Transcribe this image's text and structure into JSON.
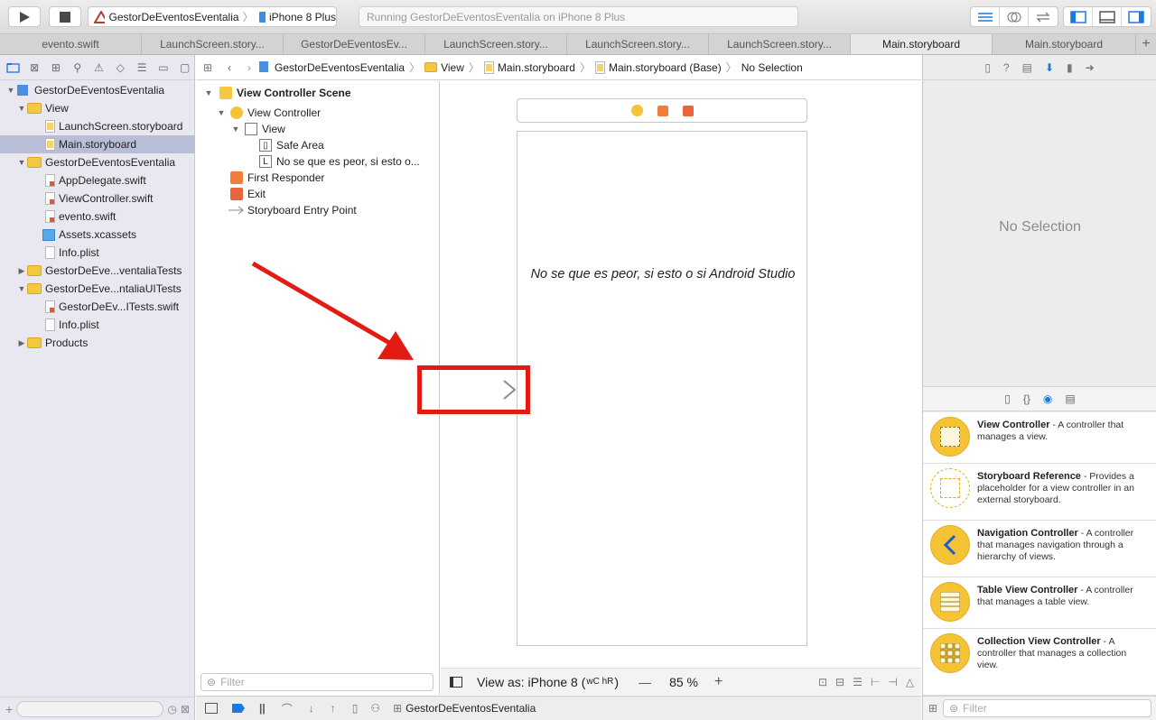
{
  "toolbar": {
    "scheme_name": "GestorDeEventosEventalia",
    "device": "iPhone 8 Plus",
    "status": "Running GestorDeEventosEventalia on iPhone 8 Plus"
  },
  "tabs": [
    {
      "label": "evento.swift"
    },
    {
      "label": "LaunchScreen.story..."
    },
    {
      "label": "GestorDeEventosEv..."
    },
    {
      "label": "LaunchScreen.story..."
    },
    {
      "label": "LaunchScreen.story..."
    },
    {
      "label": "LaunchScreen.story..."
    },
    {
      "label": "Main.storyboard"
    },
    {
      "label": "Main.storyboard"
    }
  ],
  "navigator": {
    "items": [
      {
        "label": "GestorDeEventosEventalia"
      },
      {
        "label": "View"
      },
      {
        "label": "LaunchScreen.storyboard"
      },
      {
        "label": "Main.storyboard"
      },
      {
        "label": "GestorDeEventosEventalia"
      },
      {
        "label": "AppDelegate.swift"
      },
      {
        "label": "ViewController.swift"
      },
      {
        "label": "evento.swift"
      },
      {
        "label": "Assets.xcassets"
      },
      {
        "label": "Info.plist"
      },
      {
        "label": "GestorDeEve...ventaliaTests"
      },
      {
        "label": "GestorDeEve...ntaliaUITests"
      },
      {
        "label": "GestorDeEv...ITests.swift"
      },
      {
        "label": "Info.plist"
      },
      {
        "label": "Products"
      }
    ]
  },
  "jumpbar": [
    "GestorDeEventosEventalia",
    "View",
    "Main.storyboard",
    "Main.storyboard (Base)",
    "No Selection"
  ],
  "outline": {
    "scene": "View Controller Scene",
    "view_controller": "View Controller",
    "view": "View",
    "safe_area": "Safe Area",
    "label": "No se que es peor, si esto o...",
    "first_responder": "First Responder",
    "exit": "Exit",
    "entry_point": "Storyboard Entry Point",
    "filter_placeholder": "Filter"
  },
  "canvas": {
    "label_text": "No se que es peor, si esto o si Android Studio",
    "view_as": "View as: iPhone 8 (",
    "size_classes": "wC hR",
    "view_as_close": ")",
    "zoom": "85 %",
    "zoom_out": "—",
    "zoom_in": "+"
  },
  "debugbar": {
    "target": "GestorDeEventosEventalia"
  },
  "inspector": {
    "no_selection": "No Selection",
    "filter_placeholder": "Filter",
    "library": [
      {
        "title": "View Controller",
        "desc": " - A controller that manages a view."
      },
      {
        "title": "Storyboard Reference",
        "desc": " - Provides a placeholder for a view controller in an external storyboard."
      },
      {
        "title": "Navigation Controller",
        "desc": " - A controller that manages navigation through a hierarchy of views."
      },
      {
        "title": "Table View Controller",
        "desc": " - A controller that manages a table view."
      },
      {
        "title": "Collection View Controller",
        "desc": " - A controller that manages a collection view."
      }
    ]
  },
  "colors": {
    "annotation_red": "#e31c13",
    "folder_yellow": "#f5c842",
    "selection": "#b8bed5",
    "accent_blue": "#1a7ae2"
  }
}
